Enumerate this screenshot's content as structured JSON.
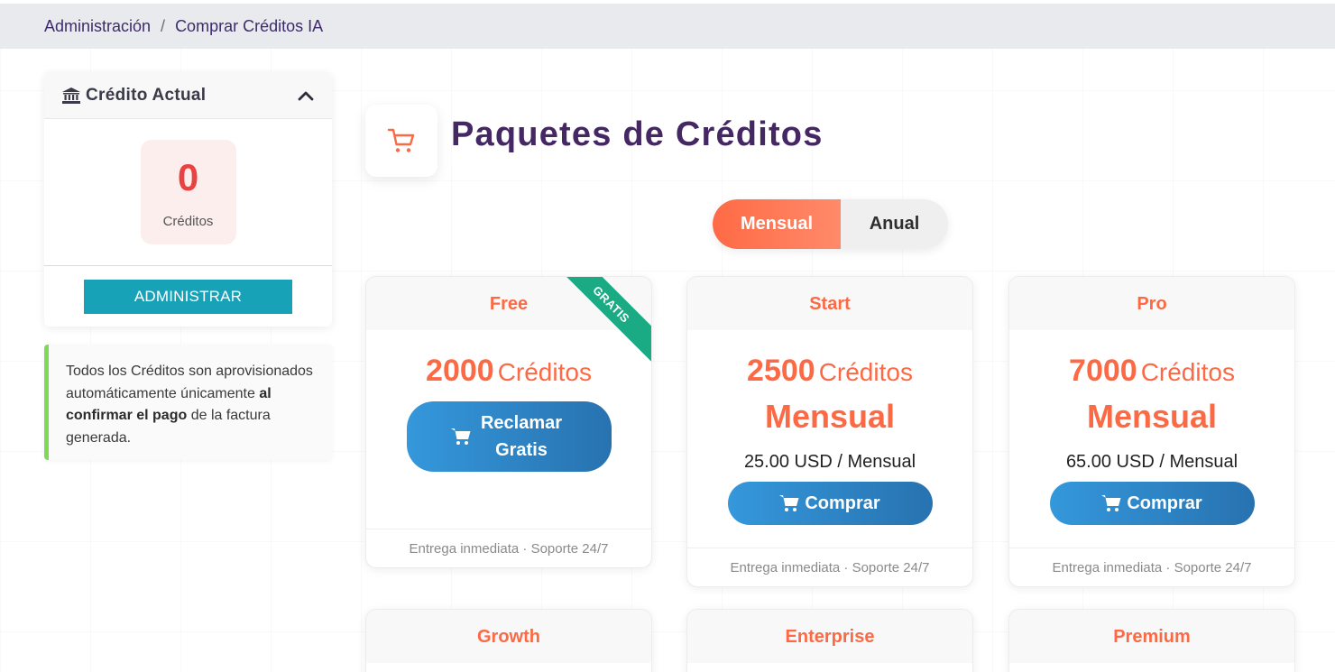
{
  "breadcrumb": {
    "items": [
      "Administración",
      "Comprar Créditos IA"
    ],
    "separator": "/"
  },
  "sidebar": {
    "card_title": "Crédito Actual",
    "credit_value": "0",
    "credit_label": "Créditos",
    "admin_button": "ADMINISTRAR",
    "info_pre": "Todos los Créditos son aprovisionados automáticamente únicamente ",
    "info_bold": "al confirmar el pago",
    "info_post": " de la factura generada."
  },
  "main": {
    "title": "Paquetes de Créditos",
    "toggle": {
      "active": "Mensual",
      "inactive": "Anual"
    }
  },
  "plans": [
    {
      "name": "Free",
      "credits": "2000",
      "unit": "Créditos",
      "ribbon": "GRATIS",
      "button": "Reclamar Gratis",
      "footer": "Entrega inmediata · Soporte 24/7"
    },
    {
      "name": "Start",
      "credits": "2500",
      "unit": "Créditos",
      "period": "Mensual",
      "price": "25.00 USD / Mensual",
      "button": "Comprar",
      "footer": "Entrega inmediata · Soporte 24/7"
    },
    {
      "name": "Pro",
      "credits": "7000",
      "unit": "Créditos",
      "period": "Mensual",
      "price": "65.00 USD / Mensual",
      "button": "Comprar",
      "footer": "Entrega inmediata · Soporte 24/7"
    },
    {
      "name": "Growth"
    },
    {
      "name": "Enterprise"
    },
    {
      "name": "Premium"
    }
  ],
  "colors": {
    "accent": "#fb6a45",
    "title": "#452764",
    "info_border": "#7ed957",
    "admin_button": "#17a2b8",
    "ribbon": "#1aab84",
    "buy_button": "#2f86c9"
  },
  "icons": [
    "bank-icon",
    "chevron-up-icon",
    "cart-icon"
  ]
}
